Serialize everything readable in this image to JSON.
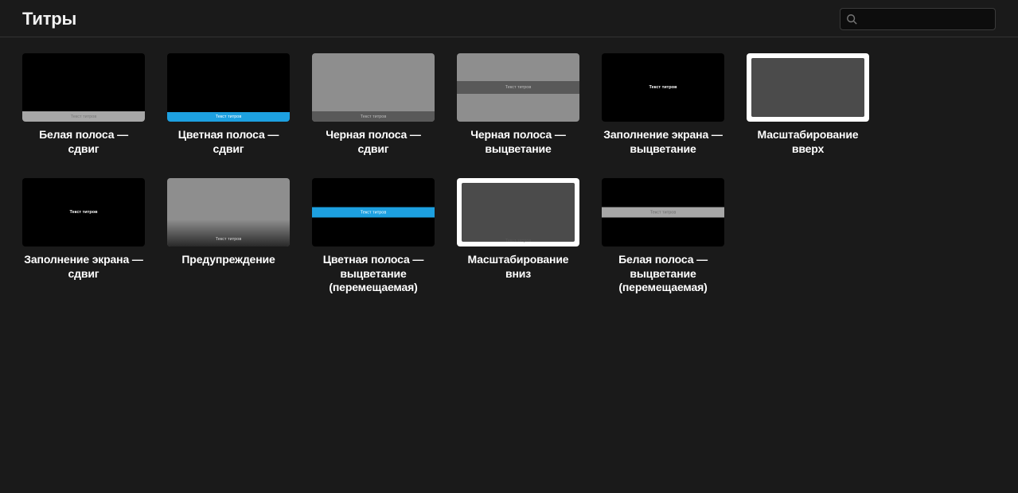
{
  "header": {
    "title": "Титры",
    "search_placeholder": ""
  },
  "thumb_text": "Текст титров",
  "tiles": [
    {
      "label": "Белая полоса — сдвиг"
    },
    {
      "label": "Цветная полоса — сдвиг"
    },
    {
      "label": "Черная полоса — сдвиг"
    },
    {
      "label": "Черная полоса — выцветание"
    },
    {
      "label": "Заполнение экрана — выцветание"
    },
    {
      "label": "Масштабирование вверх"
    },
    {
      "label": "Заполнение экрана — сдвиг"
    },
    {
      "label": "Предупреждение"
    },
    {
      "label": "Цветная полоса — выцветание (перемещаемая)"
    },
    {
      "label": "Масштабирование вниз"
    },
    {
      "label": "Белая полоса — выцветание (перемещаемая)"
    }
  ]
}
